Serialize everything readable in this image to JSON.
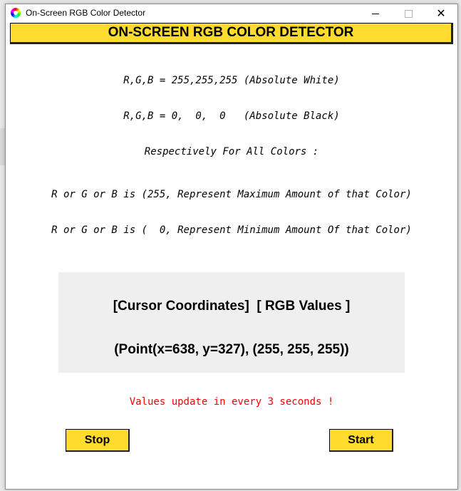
{
  "window": {
    "title": "On-Screen RGB Color Detector",
    "close_glyph": "✕"
  },
  "banner": {
    "heading": "ON-SCREEN RGB COLOR DETECTOR"
  },
  "info": {
    "white_line": "R,G,B = 255,255,255 (Absolute White)",
    "black_line": "R,G,B = 0,  0,  0   (Absolute Black)",
    "respectively_line": "Respectively For All Colors :",
    "max_line": "R or G or B is (255, Represent Maximum Amount of that Color)",
    "min_line": "R or G or B is (  0, Represent Minimum Amount Of that Color)"
  },
  "readout": {
    "header": "[Cursor Coordinates]  [ RGB Values ]",
    "value": "(Point(x=638, y=327), (255, 255, 255))"
  },
  "update_note": "Values update in every 3 seconds !",
  "buttons": {
    "stop": "Stop",
    "start": "Start"
  },
  "colors": {
    "accent_yellow": "#fedb2d",
    "panel_gray": "#efefef",
    "note_red": "#ff0000"
  },
  "icons": {
    "app": "color-wheel-icon",
    "minimize": "minimize-icon",
    "maximize": "maximize-icon",
    "close": "close-icon"
  }
}
